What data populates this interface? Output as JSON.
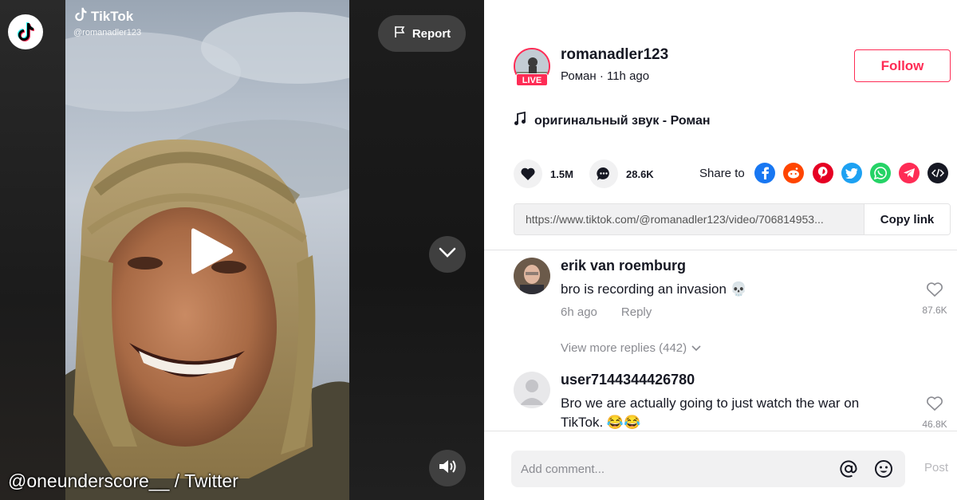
{
  "video": {
    "watermark_brand": "TikTok",
    "watermark_user": "@romanadler123",
    "report_label": "Report",
    "credit": "@oneunderscore__ / Twitter"
  },
  "author": {
    "username": "romanadler123",
    "display_name": "Роман",
    "time_ago": "11h ago",
    "separator": "·",
    "live_badge": "LIVE",
    "follow_label": "Follow"
  },
  "music": {
    "title": "оригинальный звук - Роман"
  },
  "stats": {
    "likes": "1.5M",
    "comments": "28.6K"
  },
  "share": {
    "label": "Share to",
    "targets": [
      "facebook-icon",
      "reddit-icon",
      "pinterest-icon",
      "twitter-icon",
      "whatsapp-icon",
      "telegram-icon",
      "embed-icon"
    ]
  },
  "link": {
    "url": "https://www.tiktok.com/@romanadler123/video/706814953...",
    "copy_label": "Copy link"
  },
  "comments": [
    {
      "user": "erik van roemburg",
      "text": "bro is recording an invasion 💀",
      "time": "6h ago",
      "reply_label": "Reply",
      "likes": "87.6K"
    },
    {
      "user": "user7144344426780",
      "text": "Bro we are actually going to just watch the war on TikTok. 😂😂",
      "likes": "46.8K"
    }
  ],
  "more_replies": "View more replies (442)",
  "comment_box": {
    "placeholder": "Add comment...",
    "post_label": "Post"
  },
  "colors": {
    "brand_red": "#fe2c55",
    "text": "#161823",
    "muted": "#8a8b91"
  }
}
